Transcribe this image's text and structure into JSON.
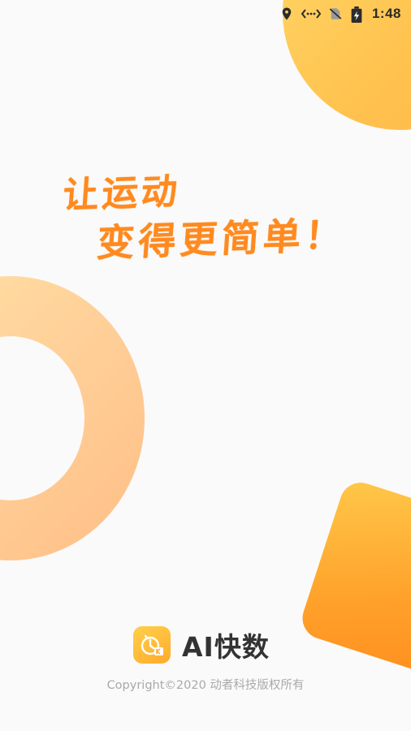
{
  "status_bar": {
    "icons": [
      "location-icon",
      "data-transfer-icon",
      "no-sim-icon",
      "battery-charging-icon"
    ],
    "time": "1:48"
  },
  "slogan": {
    "line1": "让运动",
    "line2": "变得更简单！"
  },
  "brand": {
    "icon": "stopwatch-logo-icon",
    "name": "AI快数"
  },
  "footer": {
    "copyright": "Copyright©2020 动者科技版权所有"
  },
  "colors": {
    "accent_orange": "#ff8a1f",
    "yellow": "#ffc24e",
    "background": "#fafafa",
    "text_dark": "#333333",
    "text_muted": "#a9a9a9"
  }
}
